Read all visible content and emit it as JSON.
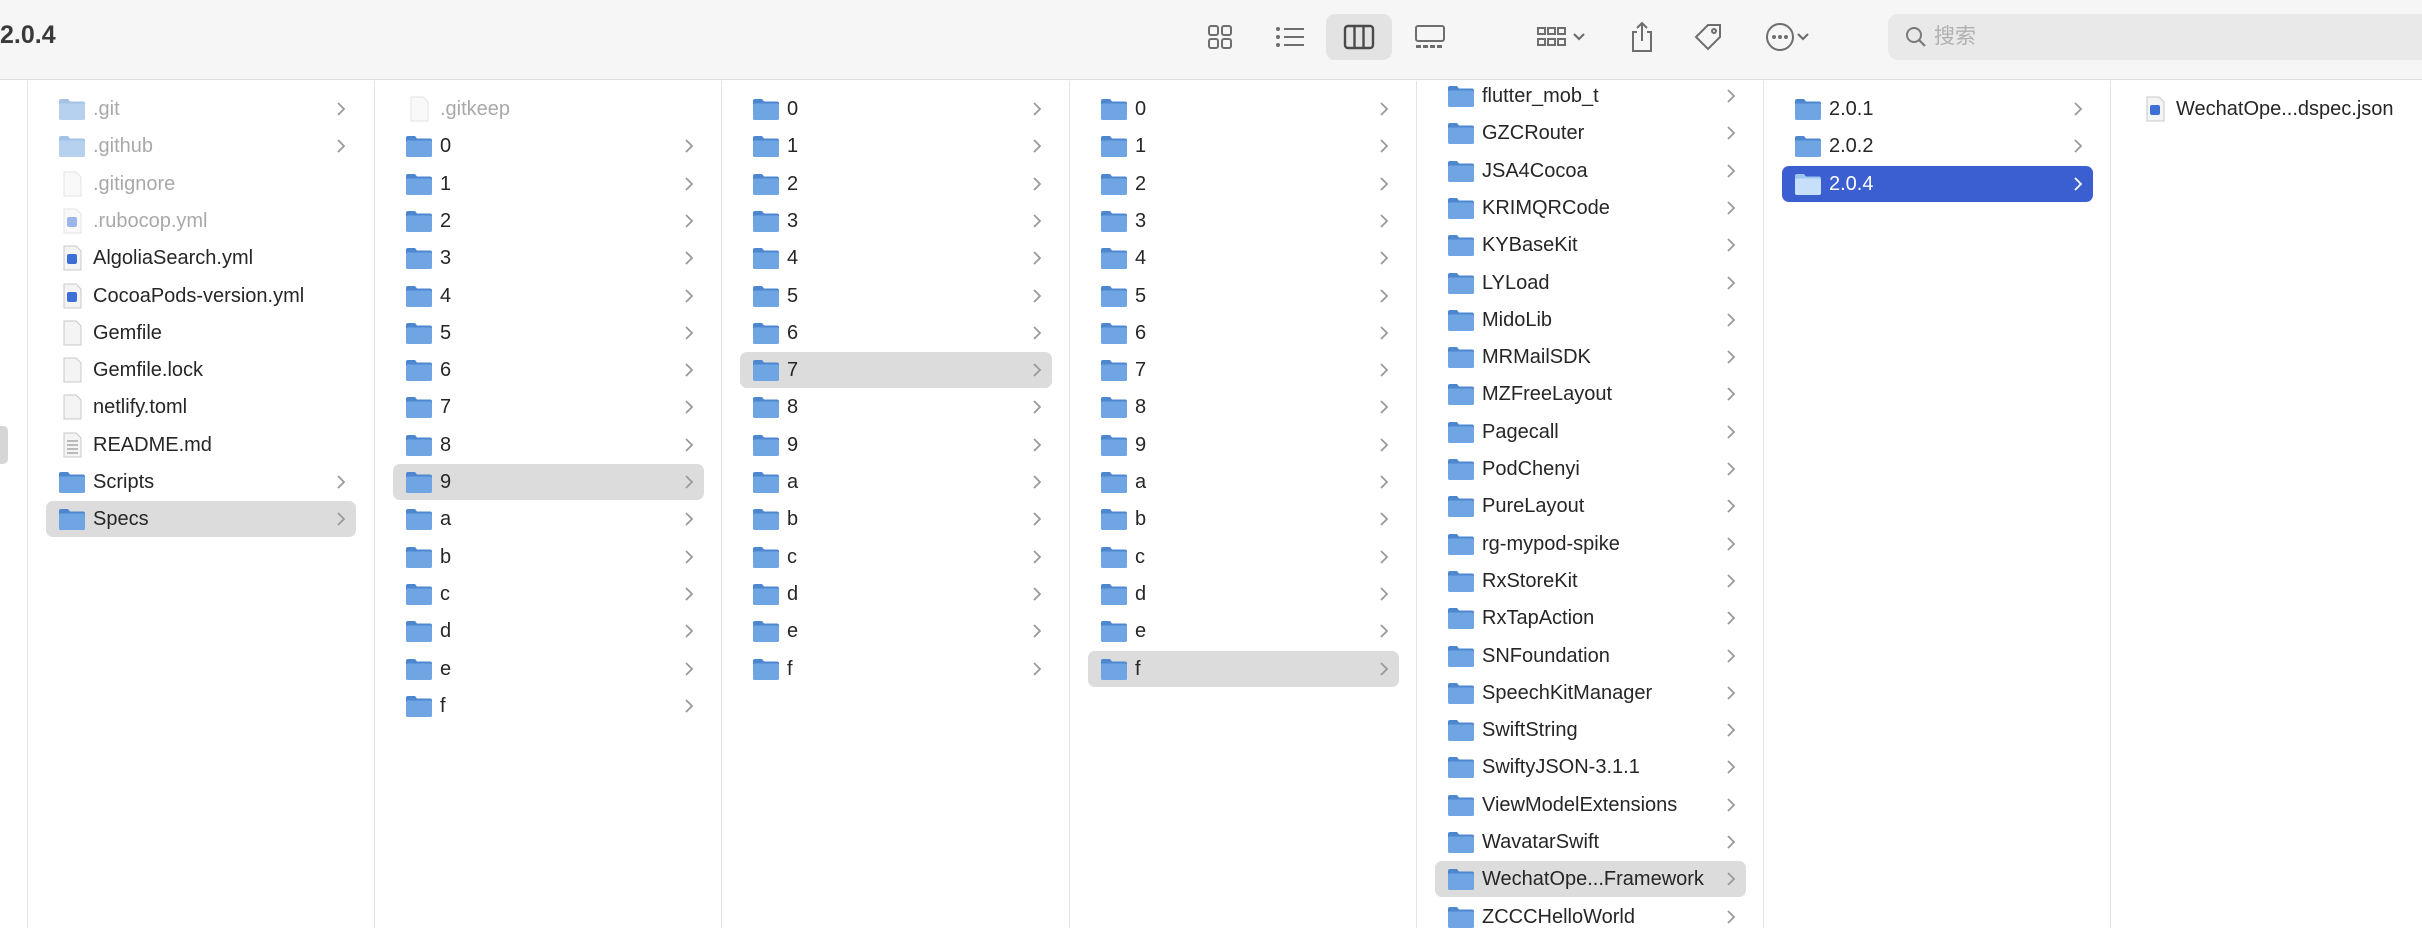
{
  "window": {
    "title": "2.0.4"
  },
  "toolbar": {
    "views": [
      "icon-view",
      "list-view",
      "column-view",
      "gallery-view"
    ],
    "active_view": "column-view",
    "group_label": "group",
    "share_label": "share",
    "tags_label": "tags",
    "more_label": "more"
  },
  "search": {
    "value": "",
    "placeholder": "搜索"
  },
  "columns": [
    {
      "items": [
        {
          "name": ".git",
          "type": "folder",
          "dim": true,
          "chevron": true
        },
        {
          "name": ".github",
          "type": "folder",
          "dim": true,
          "chevron": true
        },
        {
          "name": ".gitignore",
          "type": "file",
          "dim": true
        },
        {
          "name": ".rubocop.yml",
          "type": "yml",
          "dim": true
        },
        {
          "name": "AlgoliaSearch.yml",
          "type": "yml"
        },
        {
          "name": "CocoaPods-version.yml",
          "type": "yml"
        },
        {
          "name": "Gemfile",
          "type": "file"
        },
        {
          "name": "Gemfile.lock",
          "type": "file"
        },
        {
          "name": "netlify.toml",
          "type": "file"
        },
        {
          "name": "README.md",
          "type": "md"
        },
        {
          "name": "Scripts",
          "type": "folder",
          "chevron": true
        },
        {
          "name": "Specs",
          "type": "folder",
          "chevron": true,
          "selected": "gray"
        }
      ]
    },
    {
      "items": [
        {
          "name": ".gitkeep",
          "type": "file",
          "dim": true
        },
        {
          "name": "0",
          "type": "folder",
          "chevron": true
        },
        {
          "name": "1",
          "type": "folder",
          "chevron": true
        },
        {
          "name": "2",
          "type": "folder",
          "chevron": true
        },
        {
          "name": "3",
          "type": "folder",
          "chevron": true
        },
        {
          "name": "4",
          "type": "folder",
          "chevron": true
        },
        {
          "name": "5",
          "type": "folder",
          "chevron": true
        },
        {
          "name": "6",
          "type": "folder",
          "chevron": true
        },
        {
          "name": "7",
          "type": "folder",
          "chevron": true
        },
        {
          "name": "8",
          "type": "folder",
          "chevron": true
        },
        {
          "name": "9",
          "type": "folder",
          "chevron": true,
          "selected": "gray"
        },
        {
          "name": "a",
          "type": "folder",
          "chevron": true
        },
        {
          "name": "b",
          "type": "folder",
          "chevron": true
        },
        {
          "name": "c",
          "type": "folder",
          "chevron": true
        },
        {
          "name": "d",
          "type": "folder",
          "chevron": true
        },
        {
          "name": "e",
          "type": "folder",
          "chevron": true
        },
        {
          "name": "f",
          "type": "folder",
          "chevron": true
        }
      ]
    },
    {
      "items": [
        {
          "name": "0",
          "type": "folder",
          "chevron": true
        },
        {
          "name": "1",
          "type": "folder",
          "chevron": true
        },
        {
          "name": "2",
          "type": "folder",
          "chevron": true
        },
        {
          "name": "3",
          "type": "folder",
          "chevron": true
        },
        {
          "name": "4",
          "type": "folder",
          "chevron": true
        },
        {
          "name": "5",
          "type": "folder",
          "chevron": true
        },
        {
          "name": "6",
          "type": "folder",
          "chevron": true
        },
        {
          "name": "7",
          "type": "folder",
          "chevron": true,
          "selected": "gray"
        },
        {
          "name": "8",
          "type": "folder",
          "chevron": true
        },
        {
          "name": "9",
          "type": "folder",
          "chevron": true
        },
        {
          "name": "a",
          "type": "folder",
          "chevron": true
        },
        {
          "name": "b",
          "type": "folder",
          "chevron": true
        },
        {
          "name": "c",
          "type": "folder",
          "chevron": true
        },
        {
          "name": "d",
          "type": "folder",
          "chevron": true
        },
        {
          "name": "e",
          "type": "folder",
          "chevron": true
        },
        {
          "name": "f",
          "type": "folder",
          "chevron": true
        }
      ]
    },
    {
      "items": [
        {
          "name": "0",
          "type": "folder",
          "chevron": true
        },
        {
          "name": "1",
          "type": "folder",
          "chevron": true
        },
        {
          "name": "2",
          "type": "folder",
          "chevron": true
        },
        {
          "name": "3",
          "type": "folder",
          "chevron": true
        },
        {
          "name": "4",
          "type": "folder",
          "chevron": true
        },
        {
          "name": "5",
          "type": "folder",
          "chevron": true
        },
        {
          "name": "6",
          "type": "folder",
          "chevron": true
        },
        {
          "name": "7",
          "type": "folder",
          "chevron": true
        },
        {
          "name": "8",
          "type": "folder",
          "chevron": true
        },
        {
          "name": "9",
          "type": "folder",
          "chevron": true
        },
        {
          "name": "a",
          "type": "folder",
          "chevron": true
        },
        {
          "name": "b",
          "type": "folder",
          "chevron": true
        },
        {
          "name": "c",
          "type": "folder",
          "chevron": true
        },
        {
          "name": "d",
          "type": "folder",
          "chevron": true
        },
        {
          "name": "e",
          "type": "folder",
          "chevron": true
        },
        {
          "name": "f",
          "type": "folder",
          "chevron": true,
          "selected": "gray"
        }
      ]
    },
    {
      "items": [
        {
          "name": "flutter_mob_t",
          "type": "folder",
          "chevron": true
        },
        {
          "name": "GZCRouter",
          "type": "folder",
          "chevron": true
        },
        {
          "name": "JSA4Cocoa",
          "type": "folder",
          "chevron": true
        },
        {
          "name": "KRIMQRCode",
          "type": "folder",
          "chevron": true
        },
        {
          "name": "KYBaseKit",
          "type": "folder",
          "chevron": true
        },
        {
          "name": "LYLoad",
          "type": "folder",
          "chevron": true
        },
        {
          "name": "MidoLib",
          "type": "folder",
          "chevron": true
        },
        {
          "name": "MRMailSDK",
          "type": "folder",
          "chevron": true
        },
        {
          "name": "MZFreeLayout",
          "type": "folder",
          "chevron": true
        },
        {
          "name": "Pagecall",
          "type": "folder",
          "chevron": true
        },
        {
          "name": "PodChenyi",
          "type": "folder",
          "chevron": true
        },
        {
          "name": "PureLayout",
          "type": "folder",
          "chevron": true
        },
        {
          "name": "rg-mypod-spike",
          "type": "folder",
          "chevron": true
        },
        {
          "name": "RxStoreKit",
          "type": "folder",
          "chevron": true
        },
        {
          "name": "RxTapAction",
          "type": "folder",
          "chevron": true
        },
        {
          "name": "SNFoundation",
          "type": "folder",
          "chevron": true
        },
        {
          "name": "SpeechKitManager",
          "type": "folder",
          "chevron": true
        },
        {
          "name": "SwiftString",
          "type": "folder",
          "chevron": true
        },
        {
          "name": "SwiftyJSON-3.1.1",
          "type": "folder",
          "chevron": true
        },
        {
          "name": "ViewModelExtensions",
          "type": "folder",
          "chevron": true
        },
        {
          "name": "WavatarSwift",
          "type": "folder",
          "chevron": true
        },
        {
          "name": "WechatOpe...Framework",
          "type": "folder",
          "chevron": true,
          "selected": "gray"
        },
        {
          "name": "ZCCCHelloWorld",
          "type": "folder",
          "chevron": true
        }
      ]
    },
    {
      "items": [
        {
          "name": "2.0.1",
          "type": "folder",
          "chevron": true
        },
        {
          "name": "2.0.2",
          "type": "folder",
          "chevron": true
        },
        {
          "name": "2.0.4",
          "type": "folder",
          "chevron": true,
          "selected": "blue"
        }
      ]
    },
    {
      "items": [
        {
          "name": "WechatOpe...dspec.json",
          "type": "json"
        }
      ]
    }
  ],
  "colors": {
    "folder": "#6fa5e3",
    "folder_dark": "#4d87cf",
    "selection_blue": "#3b5fd0",
    "selection_gray": "#dcdcdc"
  }
}
